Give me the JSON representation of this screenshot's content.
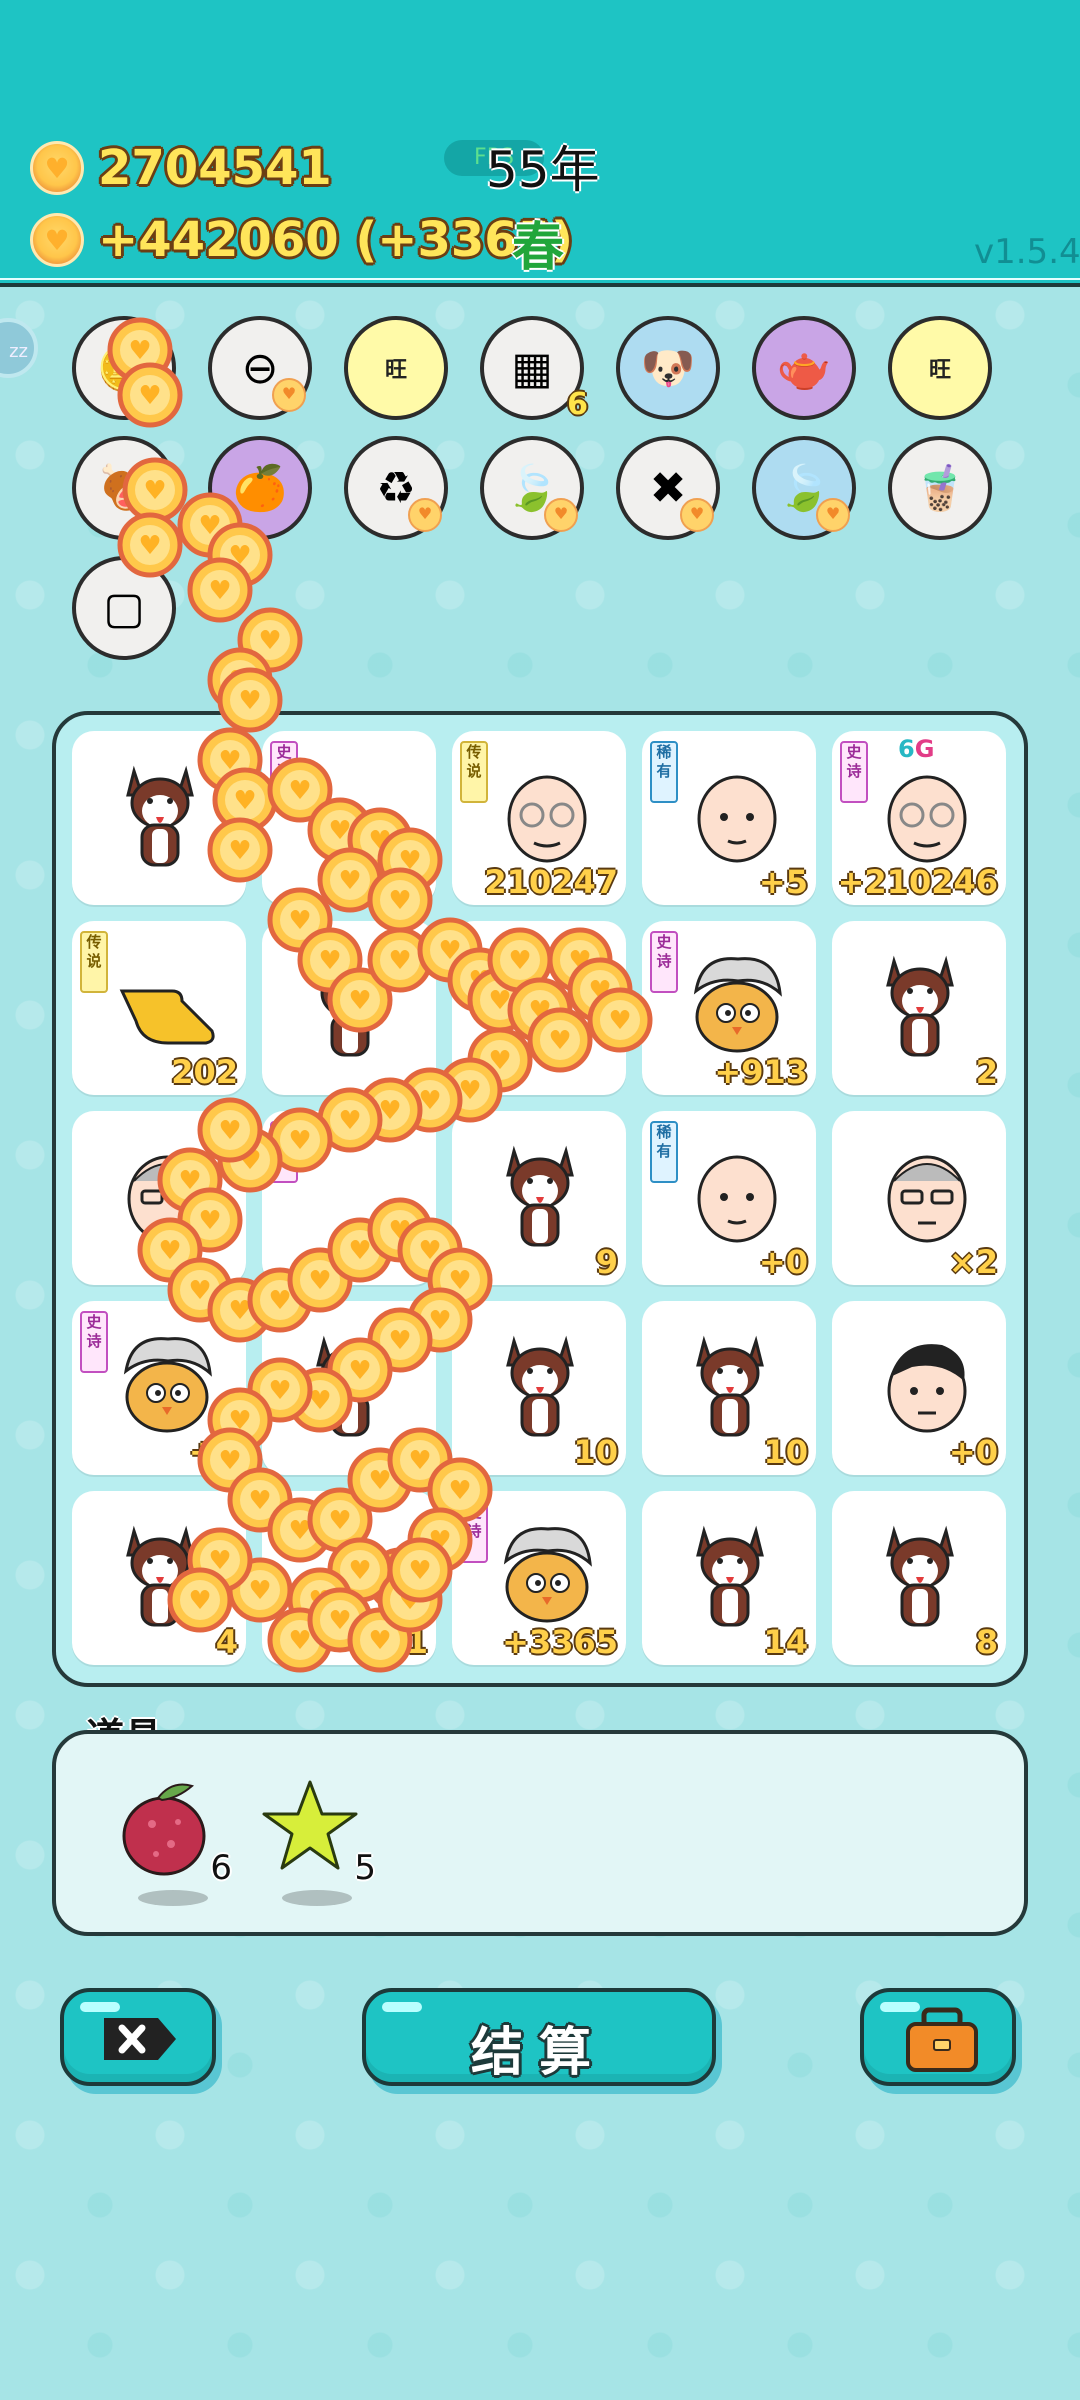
{
  "header": {
    "coins_total": "2704541",
    "coins_rate": "+442060 (+3365)",
    "fps_label": "FPS",
    "year": "55年",
    "season": "春",
    "version": "v1.5.4",
    "zz_label": "zz"
  },
  "buffs": [
    {
      "name": "coin-stack",
      "icon": "🪙",
      "badge": ""
    },
    {
      "name": "minus",
      "icon": "⊖",
      "badge": ""
    },
    {
      "name": "wang",
      "icon": "旺",
      "badge": ""
    },
    {
      "name": "egg-carton",
      "icon": "▦",
      "badge": "6"
    },
    {
      "name": "dog-glasses",
      "icon": "🐶",
      "badge": ""
    },
    {
      "name": "gravy-boat",
      "icon": "🫖",
      "badge": ""
    },
    {
      "name": "wang-2",
      "icon": "旺",
      "badge": ""
    },
    {
      "name": "dog-food",
      "icon": "🍖",
      "badge": ""
    },
    {
      "name": "pomelo",
      "icon": "🍊",
      "badge": ""
    },
    {
      "name": "refresh",
      "icon": "♻",
      "badge": ""
    },
    {
      "name": "leaf",
      "icon": "🍃",
      "badge": ""
    },
    {
      "name": "delete-tag",
      "icon": "✖",
      "badge": ""
    },
    {
      "name": "leaf-2",
      "icon": "🍃",
      "badge": ""
    },
    {
      "name": "boba-tea",
      "icon": "🧋",
      "badge": ""
    },
    {
      "name": "tofu",
      "icon": "▢",
      "badge": ""
    }
  ],
  "board": {
    "cells": [
      {
        "art": "husky",
        "tag": "",
        "tag_text": "",
        "value": ""
      },
      {
        "art": "hidden",
        "tag": "epic",
        "tag_text": "史诗",
        "value": ""
      },
      {
        "art": "old-man-glasses",
        "tag": "legend",
        "tag_text": "传说",
        "value": "210247"
      },
      {
        "art": "bald-man",
        "tag": "rare",
        "tag_text": "稀有",
        "value": "+5"
      },
      {
        "art": "old-man-glasses",
        "tag": "epic",
        "tag_text": "史诗",
        "value": "+210246",
        "extra": "6G"
      },
      {
        "art": "pointing-hand",
        "tag": "legend",
        "tag_text": "传说",
        "value": "202"
      },
      {
        "art": "husky",
        "tag": "",
        "tag_text": "",
        "value": ""
      },
      {
        "art": "hidden",
        "tag": "",
        "tag_text": "",
        "value": ""
      },
      {
        "art": "chick-hair",
        "tag": "epic",
        "tag_text": "史诗",
        "value": "+913"
      },
      {
        "art": "husky",
        "tag": "",
        "tag_text": "",
        "value": "2"
      },
      {
        "art": "grandpa",
        "tag": "",
        "tag_text": "",
        "value": ""
      },
      {
        "art": "hidden",
        "tag": "epic",
        "tag_text": "史诗",
        "value": ""
      },
      {
        "art": "husky",
        "tag": "",
        "tag_text": "",
        "value": "9"
      },
      {
        "art": "bald-man",
        "tag": "rare",
        "tag_text": "稀有",
        "value": "+0"
      },
      {
        "art": "grandpa",
        "tag": "",
        "tag_text": "",
        "value": "×2"
      },
      {
        "art": "chick-hair",
        "tag": "epic",
        "tag_text": "史诗",
        "value": "+4"
      },
      {
        "art": "husky",
        "tag": "",
        "tag_text": "",
        "value": ""
      },
      {
        "art": "husky",
        "tag": "",
        "tag_text": "",
        "value": "10"
      },
      {
        "art": "husky",
        "tag": "",
        "tag_text": "",
        "value": "10"
      },
      {
        "art": "man-black-hair",
        "tag": "",
        "tag_text": "",
        "value": "+0"
      },
      {
        "art": "husky",
        "tag": "",
        "tag_text": "",
        "value": "4"
      },
      {
        "art": "hidden",
        "tag": "",
        "tag_text": "",
        "value": "+1"
      },
      {
        "art": "chick-hair",
        "tag": "epic",
        "tag_text": "史诗",
        "value": "+3365"
      },
      {
        "art": "husky",
        "tag": "",
        "tag_text": "",
        "value": "14"
      },
      {
        "art": "husky",
        "tag": "",
        "tag_text": "",
        "value": "8"
      }
    ]
  },
  "props": {
    "title": "道具",
    "items": [
      {
        "name": "bayberry",
        "count": "6"
      },
      {
        "name": "star",
        "count": "5"
      }
    ]
  },
  "actions": {
    "settle_label": "结算"
  },
  "colors": {
    "header_bg": "#1ec4c4",
    "value_text": "#ffd04a",
    "season_green": "#21a63b"
  }
}
